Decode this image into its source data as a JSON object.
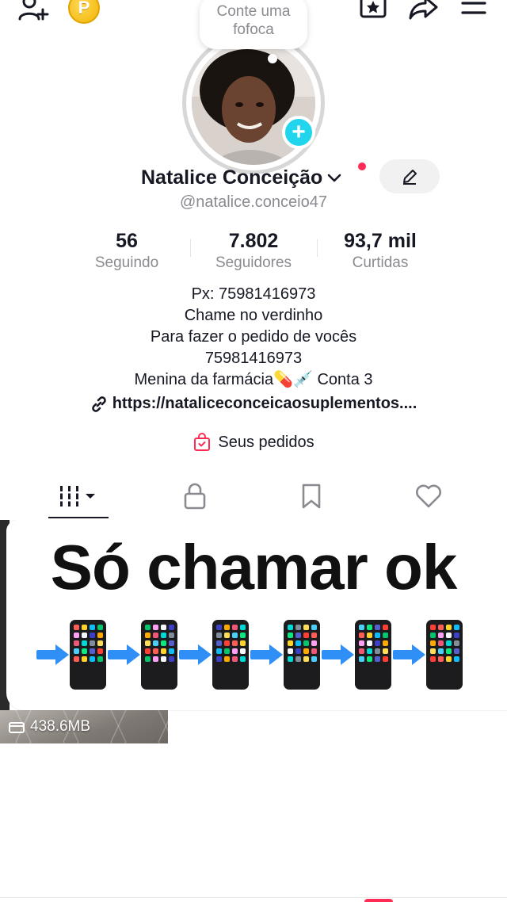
{
  "note": {
    "text": "Conte uma fofoca"
  },
  "profile": {
    "name": "Natalice Conceição",
    "handle": "@natalice.conceio47"
  },
  "stats": [
    {
      "value": "56",
      "label": "Seguindo"
    },
    {
      "value": "7.802",
      "label": "Seguidores"
    },
    {
      "value": "93,7 mil",
      "label": "Curtidas"
    }
  ],
  "bio": {
    "lines": [
      "Px: 75981416973",
      "Chame no verdinho",
      "Para fazer o pedido de vocês",
      "75981416973",
      "Menina da farmácia💊💉 Conta 3"
    ],
    "link": "https://nataliceconceicaosuplementos...."
  },
  "orders": {
    "label": "Seus pedidos"
  },
  "coin_letter": "P",
  "video": {
    "title": "Só chamar ok",
    "size": "438.6MB"
  },
  "colors": {
    "accent": "#fe2c55",
    "story_add": "#20d5ec",
    "text_secondary": "#8a8b91"
  },
  "icons": [
    "add-friend-icon",
    "coin-icon",
    "favorites-icon",
    "share-icon",
    "menu-icon",
    "edit-icon",
    "link-icon",
    "shopping-bag-icon",
    "videos-grid-icon",
    "lock-icon",
    "bookmark-icon",
    "heart-icon",
    "storage-icon"
  ]
}
